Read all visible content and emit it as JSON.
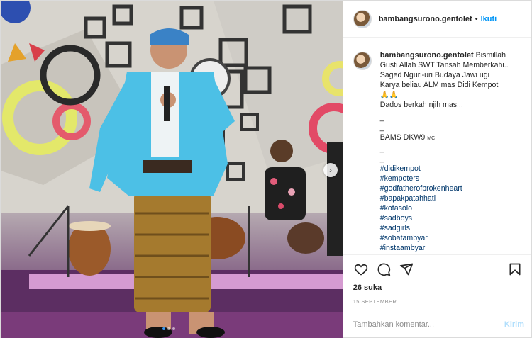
{
  "post": {
    "author": "bambangsurono.gentolet",
    "separator": "•",
    "follow_label": "Ikuti",
    "carousel_next_icon": "chevron-right-icon"
  },
  "caption": {
    "author": "bambangsurono.gentolet",
    "lines": [
      "Bismillah",
      "Gusti Allah SWT Tansah Memberkahi..",
      "Saged Nguri-uri Budaya Jawi ugi",
      "Karya beliau ALM mas Didi Kempot",
      "🙏🙏",
      "Dados berkah njih mas...",
      "_",
      "_",
      "BAMS DKW9",
      "_",
      "_"
    ],
    "mc_mark": "MC",
    "hashtags": [
      "#didikempot",
      "#kempoters",
      "#godfatherofbrokenheart",
      "#bapakpatahhati",
      "#kotasolo",
      "#sadboys",
      "#sadgirls",
      "#sobatambyar",
      "#instaambyar"
    ]
  },
  "actions": {
    "like_icon": "heart-icon",
    "comment_icon": "comment-icon",
    "share_icon": "share-icon",
    "save_icon": "bookmark-icon",
    "likes": "26 suka",
    "date": "15 SEPTEMBER"
  },
  "comment_box": {
    "placeholder": "Tambahkan komentar...",
    "post_label": "Kirim"
  },
  "colors": {
    "link": "#0095f6",
    "hashtag": "#00376b",
    "post_disabled": "#b2dffc",
    "active_dot": "#3897f0"
  }
}
